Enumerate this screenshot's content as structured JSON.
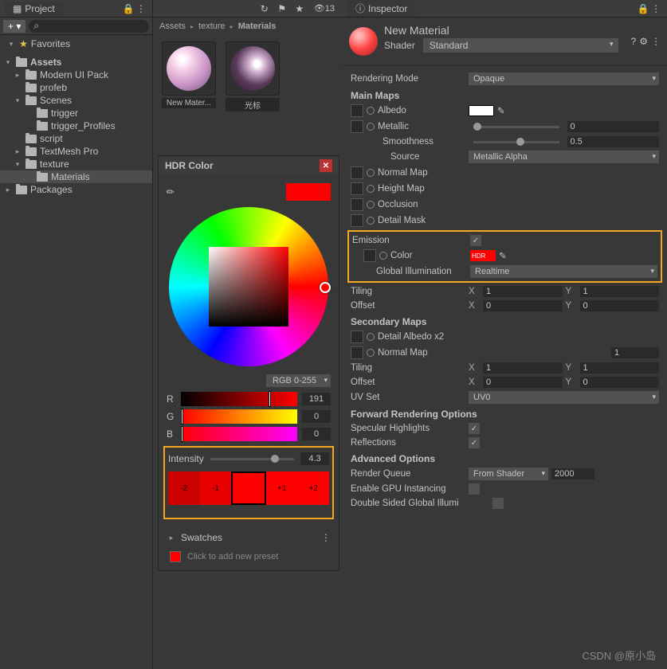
{
  "project": {
    "tab": "Project",
    "search_placeholder": "",
    "layers_count": "13",
    "favorites": "Favorites",
    "tree": {
      "assets": "Assets",
      "modern_ui": "Modern UI Pack",
      "profeb": "profeb",
      "scenes": "Scenes",
      "trigger": "trigger",
      "trigger_profiles": "trigger_Profiles",
      "script": "script",
      "textmesh": "TextMesh Pro",
      "texture": "texture",
      "materials": "Materials",
      "packages": "Packages"
    }
  },
  "assets_view": {
    "breadcrumb": [
      "Assets",
      "texture",
      "Materials"
    ],
    "items": [
      {
        "label": "New Mater..."
      },
      {
        "label": "光标"
      }
    ]
  },
  "hdr": {
    "title": "HDR Color",
    "mode": "RGB 0-255",
    "r_label": "R",
    "r_val": "191",
    "g_label": "G",
    "g_val": "0",
    "b_label": "B",
    "b_val": "0",
    "intensity_label": "Intensity",
    "intensity_val": "4.3",
    "swatches_label": "Swatches",
    "preset_hint": "Click to add new preset",
    "int_steps": [
      "-2",
      "-1",
      "",
      "+1",
      "+2"
    ]
  },
  "inspector": {
    "tab": "Inspector",
    "mat_name": "New Material",
    "shader_label": "Shader",
    "shader_val": "Standard",
    "rendering_mode": "Rendering Mode",
    "rendering_mode_val": "Opaque",
    "main_maps": "Main Maps",
    "albedo": "Albedo",
    "metallic": "Metallic",
    "metallic_val": "0",
    "smoothness": "Smoothness",
    "smoothness_val": "0.5",
    "source": "Source",
    "source_val": "Metallic Alpha",
    "normal_map": "Normal Map",
    "height_map": "Height Map",
    "occlusion": "Occlusion",
    "detail_mask": "Detail Mask",
    "emission": "Emission",
    "color": "Color",
    "color_hdr": "HDR",
    "global_illum": "Global Illumination",
    "global_illum_val": "Realtime",
    "tiling": "Tiling",
    "offset": "Offset",
    "x1": "1",
    "y1": "1",
    "x0": "0",
    "y0": "0",
    "secondary": "Secondary Maps",
    "detail_albedo": "Detail Albedo x2",
    "normal_map2_val": "1",
    "uv_set": "UV Set",
    "uv_set_val": "UV0",
    "forward": "Forward Rendering Options",
    "specular": "Specular Highlights",
    "reflections": "Reflections",
    "advanced": "Advanced Options",
    "render_queue": "Render Queue",
    "render_queue_dd": "From Shader",
    "render_queue_val": "2000",
    "gpu_inst": "Enable GPU Instancing",
    "double_sided": "Double Sided Global Illumi"
  },
  "watermark": "CSDN @原小岛"
}
